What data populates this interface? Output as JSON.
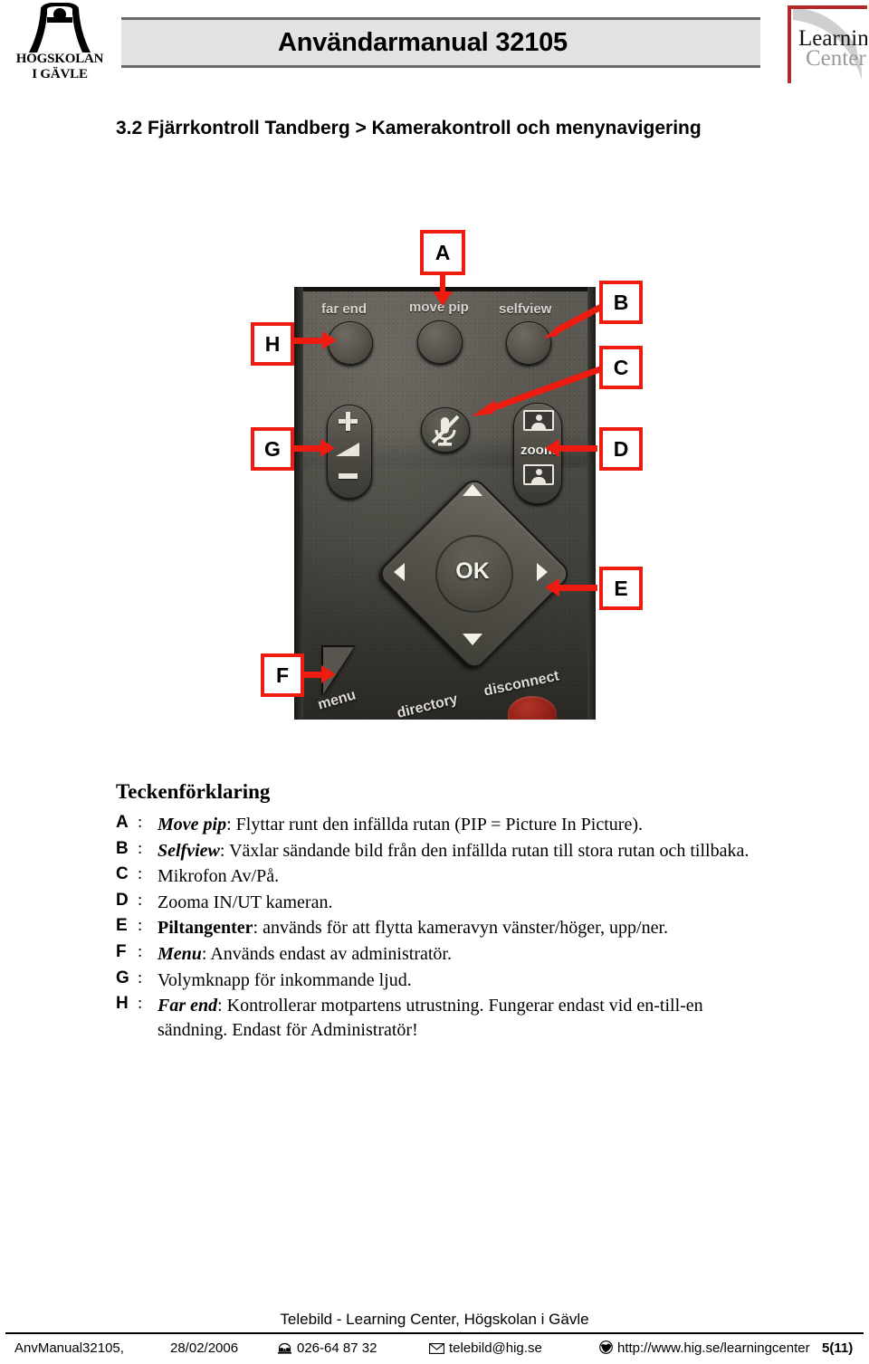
{
  "header": {
    "institution_logo_name": "hogskolan-i-gavle-logo",
    "institution_line1": "HÖGSKOLAN",
    "institution_line2": "I GÄVLE",
    "document_title": "Användarmanual 32105",
    "partner_logo_line1": "Learning",
    "partner_logo_line2": "Center",
    "accent_red": "#b02a2a"
  },
  "section": {
    "heading": "3.2 Fjärrkontroll Tandberg > Kamerakontroll och menynavigering"
  },
  "figure": {
    "caption_label": "Tandberg remote control photo",
    "remote": {
      "top_labels": [
        "far end",
        "move pip",
        "selfview"
      ],
      "zoom_label": "zoom",
      "ok_label": "OK",
      "menu_label": "menu",
      "directory_label": "directory",
      "disconnect_label": "disconnect",
      "volume_plus": "+",
      "volume_minus": "–"
    },
    "callouts": [
      {
        "id": "A",
        "label": "A",
        "target": "move pip button"
      },
      {
        "id": "B",
        "label": "B",
        "target": "selfview button"
      },
      {
        "id": "C",
        "label": "C",
        "target": "microphone mute button"
      },
      {
        "id": "D",
        "label": "D",
        "target": "zoom button"
      },
      {
        "id": "E",
        "label": "E",
        "target": "arrow keys / d-pad"
      },
      {
        "id": "F",
        "label": "F",
        "target": "menu button"
      },
      {
        "id": "G",
        "label": "G",
        "target": "volume rocker"
      },
      {
        "id": "H",
        "label": "H",
        "target": "far end button"
      }
    ],
    "callout_border_color": "#ee1b11"
  },
  "legend": {
    "title": "Teckenförklaring",
    "items": [
      {
        "key": "A",
        "keyword": "Move pip",
        "keyword_style": "bold-italic",
        "text": ": Flyttar runt den infällda rutan (PIP = Picture In Picture)."
      },
      {
        "key": "B",
        "keyword": "Selfview",
        "keyword_style": "bold-italic",
        "text": ": Växlar sändande bild från den infällda rutan till stora rutan och tillbaka."
      },
      {
        "key": "C",
        "keyword": "",
        "keyword_style": "none",
        "text": "Mikrofon Av/På."
      },
      {
        "key": "D",
        "keyword": "",
        "keyword_style": "none",
        "text": "Zooma IN/UT kameran."
      },
      {
        "key": "E",
        "keyword": "Piltangenter",
        "keyword_style": "bold",
        "text": ": används för att flytta kameravyn vänster/höger, upp/ner."
      },
      {
        "key": "F",
        "keyword": "Menu",
        "keyword_style": "bold-italic",
        "text": ": Används endast av administratör."
      },
      {
        "key": "G",
        "keyword": "",
        "keyword_style": "none",
        "text": "Volymknapp för inkommande ljud."
      },
      {
        "key": "H",
        "keyword": "Far end",
        "keyword_style": "bold-italic",
        "text": ": Kontrollerar motpartens utrustning. Fungerar endast vid en-till-en sändning. Endast för Administratör!"
      }
    ]
  },
  "footer": {
    "organisation": "Telebild - Learning Center, Högskolan i Gävle",
    "document_id": "AnvManual32105,",
    "date": "28/02/2006",
    "phone": "026-64 87 32",
    "email": "telebild@hig.se",
    "url": "http://www.hig.se/learningcenter",
    "page": "5(11)",
    "phone_icon": "telephone-icon",
    "email_icon": "envelope-icon",
    "url_icon": "globe-icon"
  }
}
